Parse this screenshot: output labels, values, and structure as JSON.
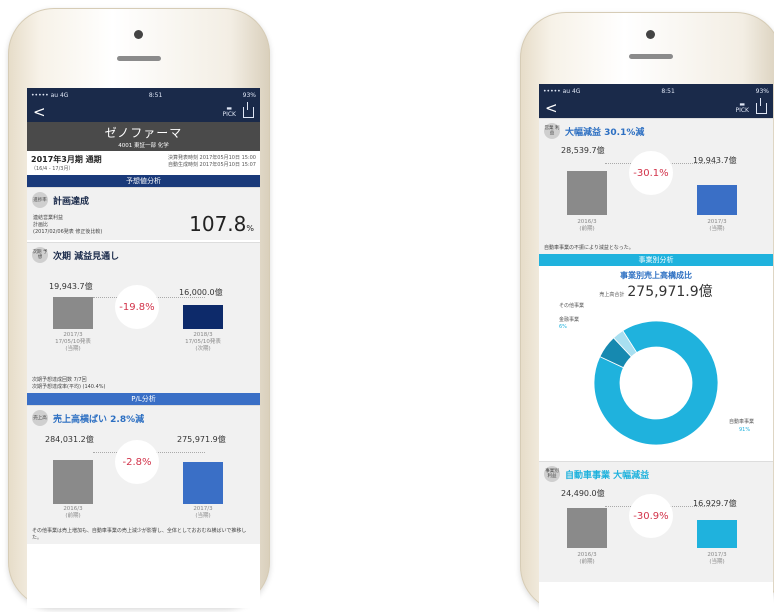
{
  "phone_left": {
    "status": {
      "carrier": "••••• au 4G",
      "time": "8:51",
      "battery": "93%"
    },
    "nav": {
      "back": "<",
      "pick": "PICK"
    },
    "company": {
      "name": "ゼノファーマ",
      "code": "4001 東証一部 化学"
    },
    "period": {
      "title": "2017年3月期 通期",
      "range": "（16/4 - 17/3月）",
      "announce1": "決算発表時刻 2017年05月10日 15:00",
      "announce2": "自動生成時刻 2017年05月10日 15:07"
    },
    "band1": "予想値分析",
    "plan": {
      "badge": "進捗率",
      "title": "計画達成",
      "l1": "連結営業利益",
      "l2": "計画比",
      "l3": "(2017/02/06発表 修正後比較)",
      "value": "107.8",
      "unit": "%"
    },
    "forecast": {
      "badge": "次期 予想",
      "title": "次期 減益見通し",
      "v1": "19,943.7億",
      "v2": "16,000.0億",
      "pct": "-19.8%",
      "x1a": "2017/3",
      "x1b": "17/05/10発表",
      "x1c": "(当期)",
      "x2a": "2018/3",
      "x2b": "17/05/10発表",
      "x2c": "(次期)",
      "n1": "次期予想達成回数 7/7回",
      "n2": "次期予想達成率(平均) (140.4%)"
    },
    "band2": "P/L分析",
    "sales": {
      "badge": "売上高",
      "title": "売上高横ばい 2.8%減",
      "v1": "284,031.2億",
      "v2": "275,971.9億",
      "pct": "-2.8%",
      "x1a": "2016/3",
      "x1b": "(前期)",
      "x2a": "2017/3",
      "x2b": "(当期)",
      "note": "その他事業は売上増加も、自動車事業の売上減少が影響し、全体としておおむね横ばいで推移した。"
    }
  },
  "phone_right": {
    "status": {
      "carrier": "••••• au 4G",
      "time": "8:51",
      "battery": "93%"
    },
    "nav": {
      "back": "<",
      "pick": "PICK"
    },
    "profit": {
      "badge": "営業 利益",
      "title": "大幅減益 30.1%減",
      "v1": "28,539.7億",
      "v2": "19,943.7億",
      "pct": "-30.1%",
      "x1a": "2016/3",
      "x1b": "(前期)",
      "x2a": "2017/3",
      "x2b": "(当期)",
      "note": "自動車事業の不振により減益となった。"
    },
    "band": "事業別分析",
    "segment": {
      "title": "事業別売上高構成比",
      "total_label": "売上高合計",
      "total": "275,971.9億",
      "l_other": "その他事業",
      "l_fin": "金融事業",
      "l_fin_pct": "6%",
      "l_auto": "自動車事業",
      "l_auto_pct": "91%",
      "shares": [
        91,
        6,
        3
      ],
      "colors": [
        "#1fb2dd",
        "#1689b0",
        "#a8dff0"
      ]
    },
    "auto": {
      "badge": "事業別 利益",
      "title": "自動車事業 大幅減益",
      "v1": "24,490.0億",
      "v2": "16,929.7億",
      "pct": "-30.9%",
      "x1a": "2016/3",
      "x1b": "(前期)",
      "x2a": "2017/3",
      "x2b": "(当期)"
    }
  }
}
